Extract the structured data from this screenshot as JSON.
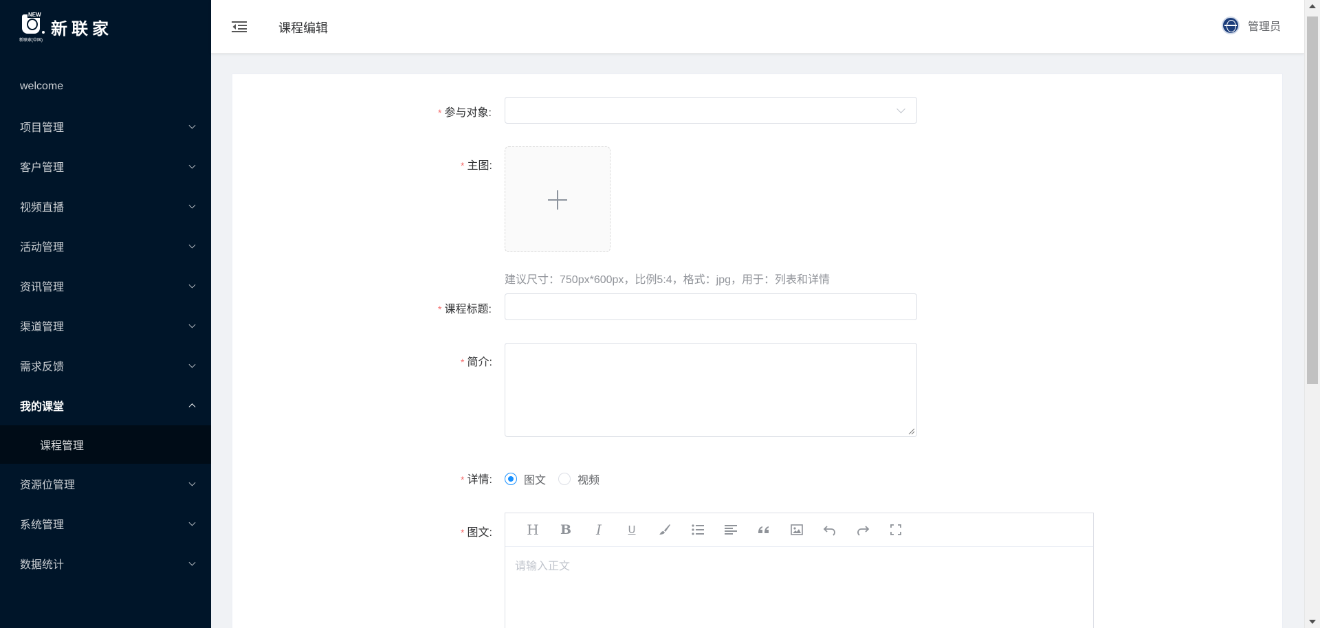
{
  "brand": {
    "logo_text": "新联家",
    "logo_badge": "NEW",
    "logo_subtext": "新联家(中国)"
  },
  "sidebar": {
    "items": [
      {
        "label": "welcome"
      },
      {
        "label": "项目管理"
      },
      {
        "label": "客户管理"
      },
      {
        "label": "视频直播"
      },
      {
        "label": "活动管理"
      },
      {
        "label": "资讯管理"
      },
      {
        "label": "渠道管理"
      },
      {
        "label": "需求反馈"
      },
      {
        "label": "我的课堂",
        "expanded": true,
        "children": [
          {
            "label": "课程管理",
            "active": true
          }
        ]
      },
      {
        "label": "资源位管理"
      },
      {
        "label": "系统管理"
      },
      {
        "label": "数据统计"
      }
    ]
  },
  "header": {
    "title": "课程编辑",
    "user_name": "管理员"
  },
  "form": {
    "audience": {
      "label": "参与对象:",
      "value": ""
    },
    "main_image": {
      "label": "主图:",
      "hint": "建议尺寸：750px*600px，比例5:4，格式：jpg，用于：列表和详情"
    },
    "course_title": {
      "label": "课程标题:",
      "value": ""
    },
    "intro": {
      "label": "简介:",
      "value": ""
    },
    "detail": {
      "label": "详情:",
      "options": [
        {
          "label": "图文",
          "checked": true
        },
        {
          "label": "视频",
          "checked": false
        }
      ]
    },
    "rich_text": {
      "label": "图文:",
      "placeholder": "请输入正文",
      "toolbar": [
        "heading-icon",
        "bold-icon",
        "italic-icon",
        "underline-icon",
        "brush-icon",
        "list-icon",
        "align-icon",
        "quote-icon",
        "image-icon",
        "undo-icon",
        "redo-icon",
        "fullscreen-icon"
      ]
    }
  },
  "colors": {
    "sidebar_bg": "#001529",
    "primary": "#1890ff",
    "required": "#f56c6c"
  }
}
